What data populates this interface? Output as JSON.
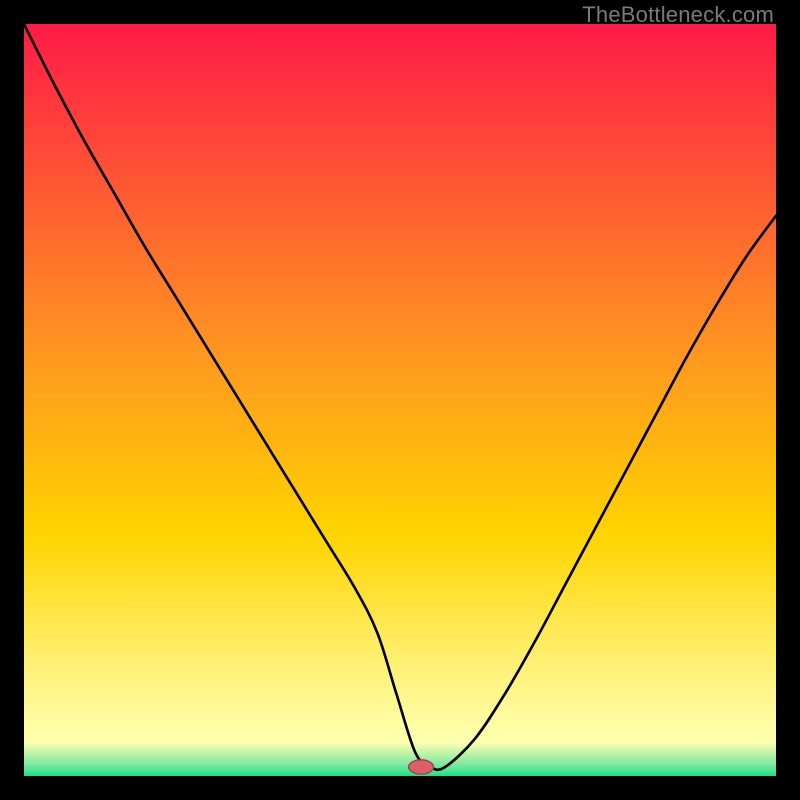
{
  "watermark": "TheBottleneck.com",
  "chart_data": {
    "type": "line",
    "title": "",
    "xlabel": "",
    "ylabel": "",
    "xlim": [
      0,
      100
    ],
    "ylim": [
      0,
      100
    ],
    "grid": false,
    "legend": false,
    "background_gradient": {
      "stops": [
        {
          "offset": 0.0,
          "color": "#ff1a47"
        },
        {
          "offset": 0.45,
          "color": "#ff9a1f"
        },
        {
          "offset": 0.68,
          "color": "#ffd400"
        },
        {
          "offset": 0.86,
          "color": "#fff27a"
        },
        {
          "offset": 0.955,
          "color": "#ffffb0"
        },
        {
          "offset": 0.985,
          "color": "#7de8a0"
        },
        {
          "offset": 1.0,
          "color": "#19e28a"
        }
      ]
    },
    "series": [
      {
        "name": "bottleneck-curve",
        "x": [
          0,
          4,
          8,
          12,
          16,
          20,
          24,
          28,
          32,
          36,
          40,
          44,
          47,
          49.5,
          52,
          54,
          56,
          60,
          64,
          68,
          72,
          76,
          80,
          84,
          88,
          92,
          96,
          100
        ],
        "y": [
          100,
          92,
          84.5,
          77.5,
          70.5,
          64,
          57.5,
          51,
          44.5,
          38,
          31.5,
          25,
          19,
          11,
          3.2,
          1.2,
          1.2,
          5,
          11,
          18,
          25.5,
          33,
          40.5,
          48,
          55.5,
          62.5,
          69,
          74.5
        ]
      }
    ],
    "minimum_marker": {
      "x": 52.8,
      "y": 1.2,
      "rx": 1.65,
      "ry": 0.95,
      "fill": "#d9606a",
      "stroke": "#a83d47"
    }
  }
}
